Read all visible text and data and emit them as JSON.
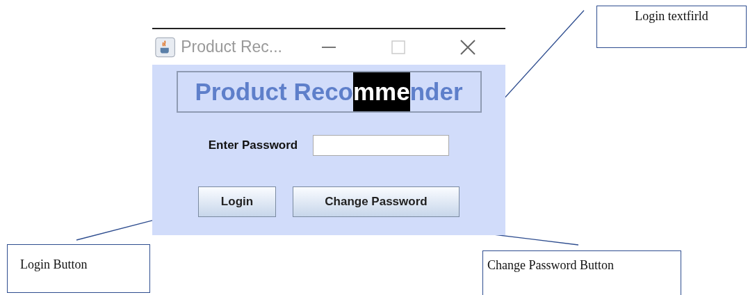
{
  "window": {
    "title": "Product Rec..."
  },
  "heading": {
    "before": "Product Reco",
    "selected": "mme",
    "after": "nder"
  },
  "password": {
    "label": "Enter Password"
  },
  "buttons": [
    {
      "label": "Login"
    },
    {
      "label": "Change Password"
    }
  ],
  "callouts": [
    {
      "text": "Login textfirld",
      "kind": "top-right"
    },
    {
      "text": "Login Button",
      "kind": "bottom-left"
    },
    {
      "text": "Change Password Button",
      "kind": "bottom-right"
    }
  ]
}
